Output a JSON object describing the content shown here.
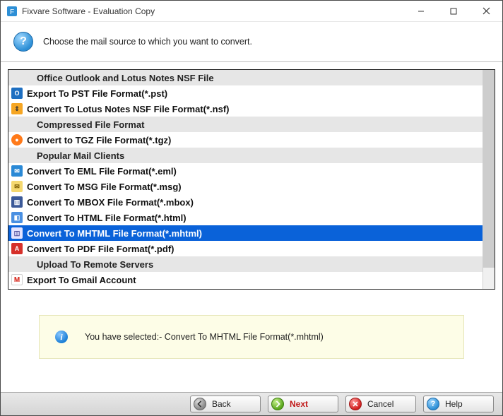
{
  "window": {
    "title": "Fixvare Software - Evaluation Copy"
  },
  "instruction": "Choose the mail source to which you want to convert.",
  "list": [
    {
      "kind": "header",
      "label": "Office Outlook and Lotus Notes NSF File"
    },
    {
      "kind": "item",
      "icon": "outlook",
      "glyph": "O",
      "label": "Export To PST File Format(*.pst)"
    },
    {
      "kind": "item",
      "icon": "nsf",
      "glyph": "⇕",
      "label": "Convert To Lotus Notes NSF File Format(*.nsf)"
    },
    {
      "kind": "header",
      "label": "Compressed File Format"
    },
    {
      "kind": "item",
      "icon": "tgz",
      "glyph": "●",
      "label": "Convert to TGZ File Format(*.tgz)"
    },
    {
      "kind": "header",
      "label": "Popular Mail Clients"
    },
    {
      "kind": "item",
      "icon": "eml",
      "glyph": "✉",
      "label": "Convert To EML File Format(*.eml)"
    },
    {
      "kind": "item",
      "icon": "msg",
      "glyph": "✉",
      "label": "Convert To MSG File Format(*.msg)"
    },
    {
      "kind": "item",
      "icon": "mbox",
      "glyph": "▥",
      "label": "Convert To MBOX File Format(*.mbox)"
    },
    {
      "kind": "item",
      "icon": "html",
      "glyph": "◧",
      "label": "Convert To HTML File Format(*.html)"
    },
    {
      "kind": "item",
      "icon": "mhtml",
      "glyph": "◫",
      "label": "Convert To MHTML File Format(*.mhtml)",
      "selected": true
    },
    {
      "kind": "item",
      "icon": "pdf",
      "glyph": "A",
      "label": "Convert To PDF File Format(*.pdf)"
    },
    {
      "kind": "header",
      "label": "Upload To Remote Servers"
    },
    {
      "kind": "item",
      "icon": "gmail",
      "glyph": "M",
      "label": "Export To Gmail Account"
    }
  ],
  "status": "You have selected:- Convert To MHTML File Format(*.mhtml)",
  "buttons": {
    "back": "Back",
    "next": "Next",
    "cancel": "Cancel",
    "help": "Help"
  }
}
